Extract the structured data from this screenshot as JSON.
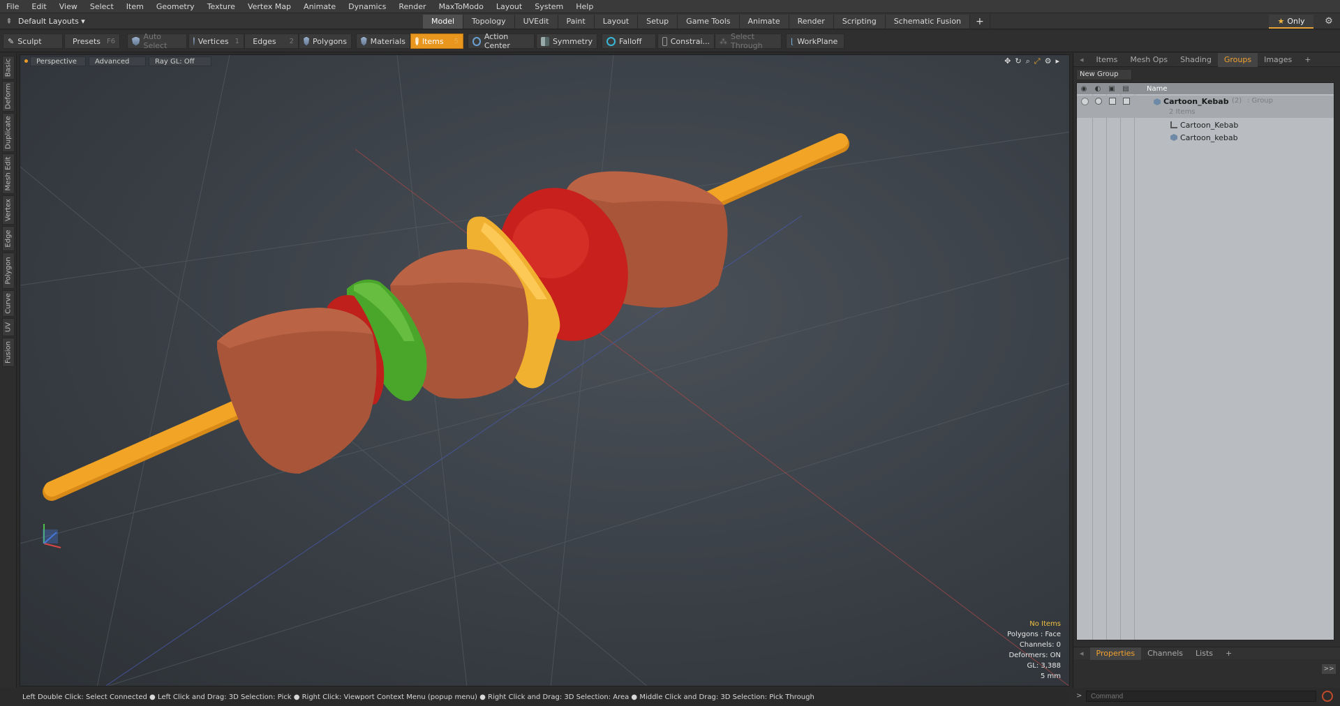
{
  "menu": [
    "File",
    "Edit",
    "View",
    "Select",
    "Item",
    "Geometry",
    "Texture",
    "Vertex Map",
    "Animate",
    "Dynamics",
    "Render",
    "MaxToModo",
    "Layout",
    "System",
    "Help"
  ],
  "layout_dropdown": "Default Layouts ▾",
  "layout_tabs": [
    "Model",
    "Topology",
    "UVEdit",
    "Paint",
    "Layout",
    "Setup",
    "Game Tools",
    "Animate",
    "Render",
    "Scripting",
    "Schematic Fusion"
  ],
  "active_layout_tab": "Model",
  "only_label": "Only",
  "toolbar": {
    "sculpt": "Sculpt",
    "presets": "Presets",
    "presets_key": "F6",
    "auto_select": "Auto Select",
    "vertices": "Vertices",
    "vertices_key": "1",
    "edges": "Edges",
    "edges_key": "2",
    "polygons": "Polygons",
    "materials": "Materials",
    "items": "Items",
    "items_key": "5",
    "action_center": "Action Center",
    "symmetry": "Symmetry",
    "falloff": "Falloff",
    "constraints": "Constrai...",
    "select_through": "Select Through",
    "workplane": "WorkPlane"
  },
  "left_tabs": [
    "Basic",
    "Deform",
    "Duplicate",
    "Mesh Edit",
    "Vertex",
    "Edge",
    "Polygon",
    "Curve",
    "UV",
    "Fusion"
  ],
  "viewport": {
    "view_mode": "Perspective",
    "advanced": "Advanced",
    "raygl": "Ray GL: Off",
    "stats": {
      "no_items": "No Items",
      "polygons": "Polygons : Face",
      "channels": "Channels: 0",
      "deformers": "Deformers: ON",
      "gl": "GL: 3,388",
      "scale": "5 mm"
    }
  },
  "status_bar": "Left Double Click: Select Connected ● Left Click and Drag: 3D Selection: Pick ● Right Click: Viewport Context Menu (popup menu) ● Right Click and Drag: 3D Selection: Area ● Middle Click and Drag: 3D Selection: Pick Through",
  "right_panel": {
    "tabs": [
      "Items",
      "Mesh Ops",
      "Shading",
      "Groups",
      "Images"
    ],
    "active_tab": "Groups",
    "new_group": "New Group",
    "column_name": "Name",
    "group": {
      "name": "Cartoon_Kebab",
      "count": "(2)",
      "type": ": Group",
      "items_label": "2 Items",
      "children": [
        "Cartoon_Kebab",
        "Cartoon_kebab"
      ]
    },
    "bottom_tabs": [
      "Properties",
      "Channels",
      "Lists"
    ],
    "active_bottom_tab": "Properties",
    "command_placeholder": "Command"
  },
  "colors": {
    "accent": "#e8961e",
    "meat": "#a8553a",
    "tomato": "#c8201c",
    "pepper_green": "#4aa62a",
    "pepper_yellow": "#f0b030",
    "skewer": "#f2a426"
  }
}
